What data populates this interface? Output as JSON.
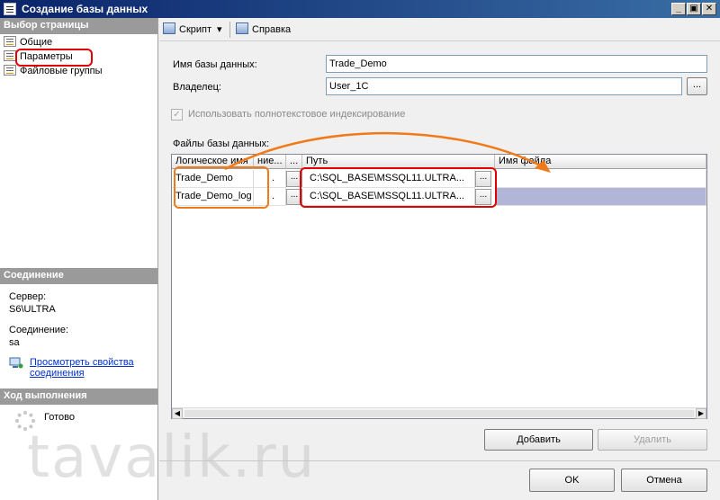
{
  "window": {
    "title": "Создание базы данных",
    "buttons": [
      "_",
      "▣",
      "✕"
    ]
  },
  "left": {
    "select_page_header": "Выбор страницы",
    "pages": [
      {
        "label": "Общие",
        "icon": "page-icon"
      },
      {
        "label": "Параметры",
        "icon": "page-icon"
      },
      {
        "label": "Файловые группы",
        "icon": "page-icon"
      }
    ],
    "connection_header": "Соединение",
    "server_label": "Сервер:",
    "server_value": "S6\\ULTRA",
    "connection_label": "Соединение:",
    "connection_value": "sa",
    "view_props_link_line1": "Просмотреть свойства",
    "view_props_link_line2": "соединения",
    "progress_header": "Ход выполнения",
    "progress_status": "Готово"
  },
  "toolbar": {
    "script_label": "Скрипт",
    "script_dropdown": "▾",
    "help_label": "Справка"
  },
  "form": {
    "db_name_label": "Имя базы данных:",
    "db_name_value": "Trade_Demo",
    "owner_label": "Владелец:",
    "owner_value": "User_1C",
    "owner_browse": "...",
    "fulltext_label": "Использовать полнотекстовое индексирование",
    "fulltext_checked": true,
    "files_label": "Файлы базы данных:"
  },
  "grid": {
    "columns": [
      "Логическое имя",
      "ние...",
      "...",
      "Путь",
      "Имя файла"
    ],
    "rows": [
      {
        "logical_name": "Trade_Demo",
        "mid": ".",
        "btn": "...",
        "path": "C:\\SQL_BASE\\MSSQL11.ULTRA...",
        "path_btn": "...",
        "file_name": ""
      },
      {
        "logical_name": "Trade_Demo_log",
        "mid": ".",
        "btn": "...",
        "path": "C:\\SQL_BASE\\MSSQL11.ULTRA...",
        "path_btn": "...",
        "file_name": ""
      }
    ],
    "scroll_left": "◀",
    "scroll_right": "▶"
  },
  "actions": {
    "add_label": "Добавить",
    "remove_label": "Удалить",
    "ok_label": "OK",
    "cancel_label": "Отмена"
  },
  "watermark": "tavalik.ru",
  "colors": {
    "title_bar": "#0a246a",
    "annotation_red": "#e00000",
    "annotation_orange": "#f07a1a",
    "selected_row": "#b1b6d6"
  }
}
